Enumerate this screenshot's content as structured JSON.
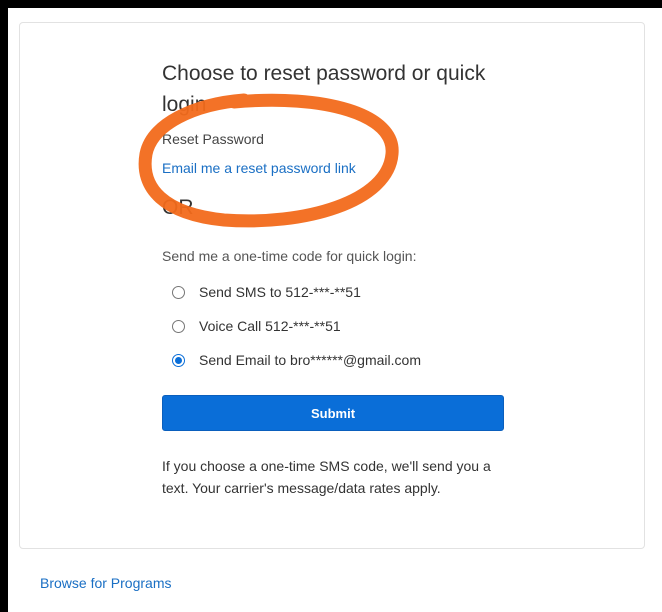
{
  "card": {
    "title": "Choose to reset password or quick login",
    "reset_label": "Reset Password",
    "reset_link": "Email me a reset password link",
    "or_text": "OR",
    "otc_label": "Send me a one-time code for quick login:",
    "options": [
      {
        "label": "Send SMS to 512-***-**51",
        "checked": false
      },
      {
        "label": "Voice Call 512-***-**51",
        "checked": false
      },
      {
        "label": "Send Email to bro******@gmail.com",
        "checked": true
      }
    ],
    "submit_label": "Submit",
    "note": "If you choose a one-time SMS code, we'll send you a text. Your carrier's message/data rates apply."
  },
  "footer": {
    "browse_link": "Browse for Programs"
  },
  "colors": {
    "accent": "#0a6ed8",
    "link": "#1a6fc4",
    "annotation": "#f26a1b"
  }
}
